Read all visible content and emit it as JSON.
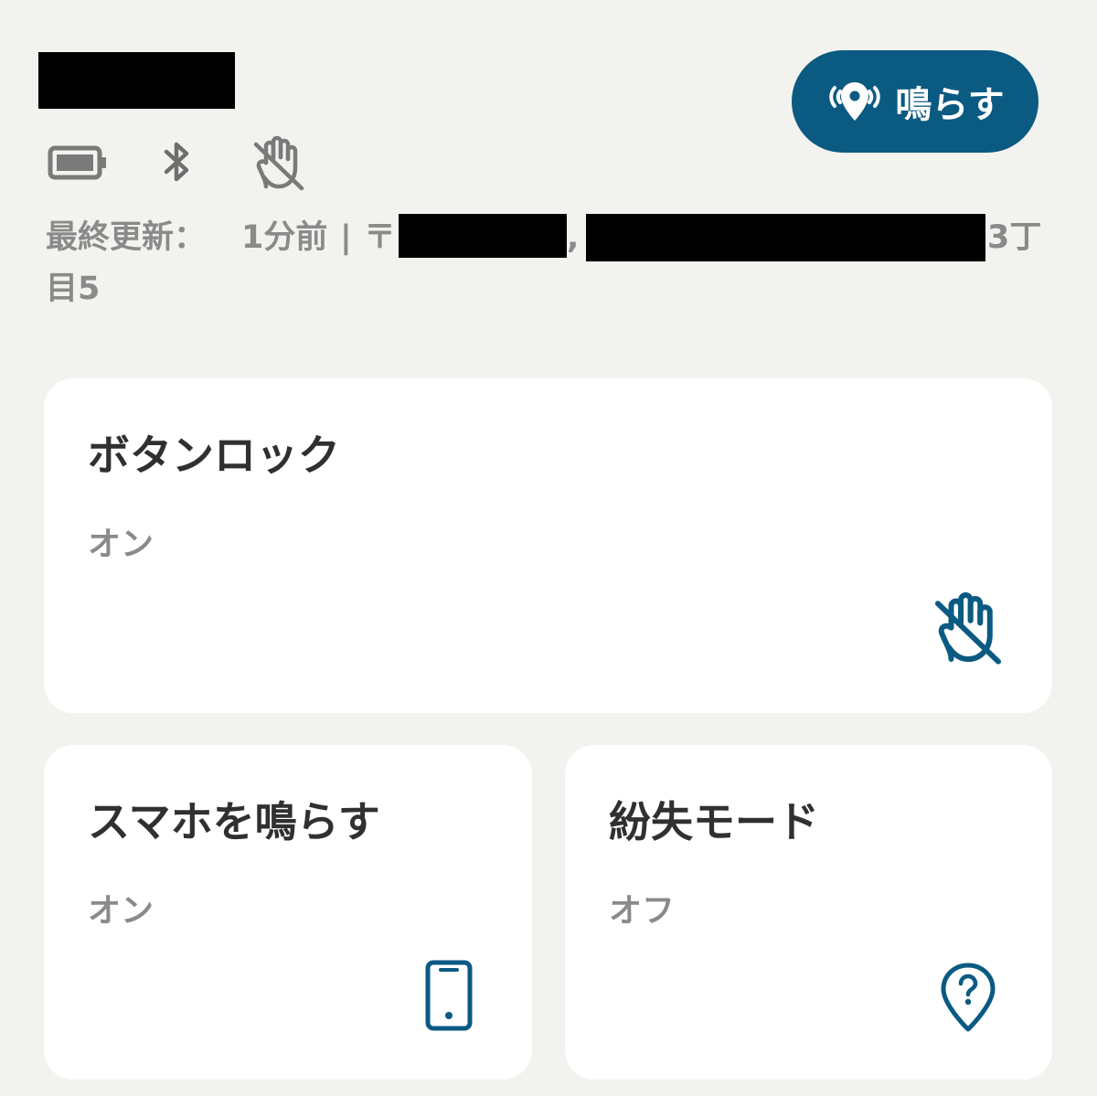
{
  "device": {
    "name_redacted": true
  },
  "status_icons": [
    "battery-icon",
    "bluetooth-icon",
    "hand-lock-off-icon"
  ],
  "ring_button": {
    "label": "鳴らす",
    "icon": "location-ring-icon",
    "color": "#0a5a82"
  },
  "last_updated": {
    "prefix": "最終更新：",
    "time": "1分前",
    "separator": "|",
    "postal_mark": "〒",
    "comma": ",",
    "suffix_line1": "3丁",
    "suffix_line2": "目5"
  },
  "cards": {
    "button_lock": {
      "title": "ボタンロック",
      "value": "オン",
      "icon": "hand-lock-off-icon"
    },
    "ring_phone": {
      "title": "スマホを鳴らす",
      "value": "オン",
      "icon": "smartphone-icon"
    },
    "lost_mode": {
      "title": "紛失モード",
      "value": "オフ",
      "icon": "location-question-icon"
    }
  },
  "colors": {
    "background": "#f2f2ee",
    "card": "#ffffff",
    "accent": "#0a5a82",
    "muted_text": "#8a8a8a"
  }
}
